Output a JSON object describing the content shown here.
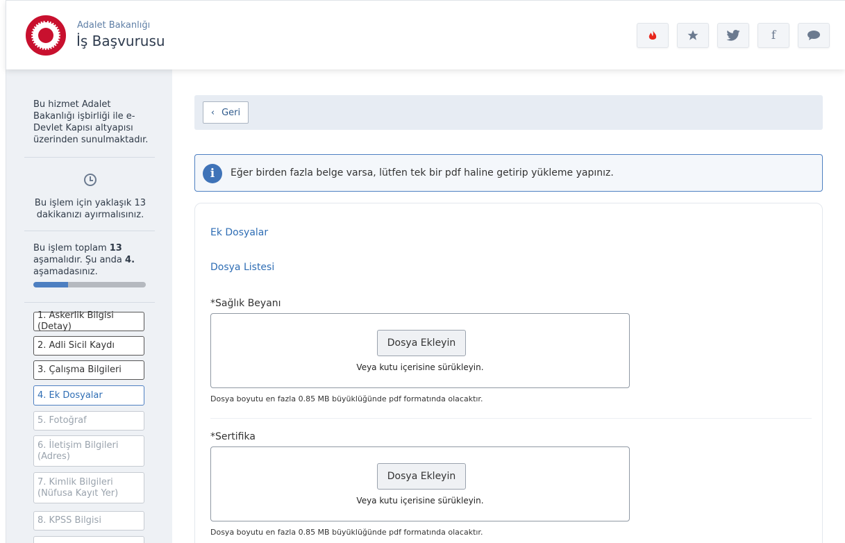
{
  "header": {
    "org_name": "Adalet Bakanlığı",
    "service_name": "İş Başvurusu",
    "buttons": [
      {
        "icon": "fire-icon",
        "glyph": "🔥",
        "color": "#e8261c"
      },
      {
        "icon": "star-icon",
        "glyph": "★"
      },
      {
        "icon": "twitter-icon",
        "glyph": "🐦"
      },
      {
        "icon": "facebook-icon",
        "glyph": "f"
      },
      {
        "icon": "comment-icon",
        "glyph": "💬"
      }
    ]
  },
  "sidebar": {
    "intro": "Bu hizmet Adalet Bakanlığı işbirliği ile e-Devlet Kapısı altyapısı üzerinden sunulmaktadır.",
    "time_text": "Bu işlem için yaklaşık 13 dakikanızı ayırmalısınız.",
    "steps_prefix": "Bu işlem toplam",
    "steps_total": "13",
    "steps_middle": "aşamalıdır. Şu anda",
    "steps_current": "4.",
    "steps_suffix": "aşamadasınız.",
    "progress_fraction": 0.31,
    "steps": [
      {
        "label": "1. Askerlik Bilgisi (Detay)",
        "state": "done"
      },
      {
        "label": "2. Adli Sicil Kaydı",
        "state": "done"
      },
      {
        "label": "3. Çalışma Bilgileri",
        "state": "done"
      },
      {
        "label": "4. Ek Dosyalar",
        "state": "active"
      },
      {
        "label": "5. Fotoğraf",
        "state": "future"
      },
      {
        "label": "6. İletişim Bilgileri (Adres)",
        "state": "future"
      },
      {
        "label": "7. Kimlik Bilgileri (Nüfusa Kayıt Yer)",
        "state": "future"
      },
      {
        "label": "8. KPSS Bilgisi",
        "state": "future"
      }
    ]
  },
  "main": {
    "back_label": "Geri",
    "info_text": "Eğer birden fazla belge varsa, lütfen tek bir pdf haline getirip yükleme yapınız.",
    "section_title": "Ek Dosyalar",
    "list_title": "Dosya Listesi",
    "files": [
      {
        "label": "*Sağlık Beyanı",
        "button": "Dosya Ekleyin",
        "hint": "Veya kutu içerisine sürükleyin.",
        "note": "Dosya boyutu en fazla 0.85 MB büyüklüğünde pdf formatında olacaktır."
      },
      {
        "label": "*Sertifika",
        "button": "Dosya Ekleyin",
        "hint": "Veya kutu içerisine sürükleyin.",
        "note": "Dosya boyutu en fazla 0.85 MB büyüklüğünde pdf formatında olacaktır."
      }
    ]
  }
}
